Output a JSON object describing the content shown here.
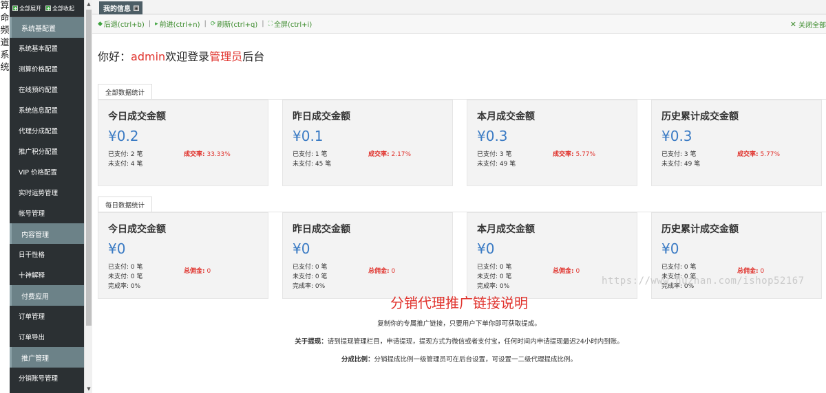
{
  "brand_chars": [
    "算",
    "命",
    "频",
    "道",
    "系",
    "统"
  ],
  "sidebar": {
    "expand_all": "全部展开",
    "collapse_all": "全部收起",
    "groups": [
      {
        "header": "系统基配置",
        "items": [
          "系统基本配置",
          "测算价格配置",
          "在线预约配置",
          "系统信息配置",
          "代理分成配置",
          "推广积分配置",
          "VIP 价格配置",
          "实时运势管理",
          "帐号管理"
        ]
      },
      {
        "header": "内容管理",
        "items": [
          "日干性格",
          "十神解释"
        ]
      },
      {
        "header": "付费应用",
        "items": [
          "订单管理",
          "订单导出"
        ]
      },
      {
        "header": "推广管理",
        "items": [
          "分销账号管理"
        ]
      }
    ]
  },
  "tabbar": {
    "tab_label": "我的信息"
  },
  "toolbar": {
    "back": "后退(ctrl+b)",
    "forward": "前进(ctrl+n)",
    "refresh": "刷新(ctrl+q)",
    "fullscreen": "全屏(ctrl+i)",
    "close_all": "关闭全部"
  },
  "greeting": {
    "prefix": "你好：",
    "user": "admin",
    "middle": "欢迎登录",
    "role": "管理员",
    "suffix": "后台"
  },
  "section_all": {
    "label": "全部数据统计",
    "cards": [
      {
        "title": "今日成交金额",
        "amount": "¥0.2",
        "paid": "已支付: 2 笔",
        "unpaid": "未支付: 4 笔",
        "rate_label": "成交率:",
        "rate": "33.33%"
      },
      {
        "title": "昨日成交金额",
        "amount": "¥0.1",
        "paid": "已支付: 1 笔",
        "unpaid": "未支付: 45 笔",
        "rate_label": "成交率:",
        "rate": "2.17%"
      },
      {
        "title": "本月成交金额",
        "amount": "¥0.3",
        "paid": "已支付: 3 笔",
        "unpaid": "未支付: 49 笔",
        "rate_label": "成交率:",
        "rate": "5.77%"
      },
      {
        "title": "历史累计成交金额",
        "amount": "¥0.3",
        "paid": "已支付: 3 笔",
        "unpaid": "未支付: 49 笔",
        "rate_label": "成交率:",
        "rate": "5.77%"
      }
    ]
  },
  "section_daily": {
    "label": "每日数据统计",
    "cards": [
      {
        "title": "今日成交金额",
        "amount": "¥0",
        "paid": "已支付: 0 笔",
        "unpaid": "未支付: 0 笔",
        "done": "完成率: 0%",
        "rate_label": "总佣金:",
        "rate": "0"
      },
      {
        "title": "昨日成交金额",
        "amount": "¥0",
        "paid": "已支付: 0 笔",
        "unpaid": "未支付: 0 笔",
        "done": "完成率: 0%",
        "rate_label": "总佣金:",
        "rate": "0"
      },
      {
        "title": "本月成交金额",
        "amount": "¥0",
        "paid": "已支付: 0 笔",
        "unpaid": "未支付: 0 笔",
        "done": "完成率: 0%",
        "rate_label": "总佣金:",
        "rate": "0"
      },
      {
        "title": "历史累计成交金额",
        "amount": "¥0",
        "paid": "已支付: 0 笔",
        "unpaid": "未支付: 0 笔",
        "done": "完成率: 0%",
        "rate_label": "总佣金:",
        "rate": "0"
      }
    ]
  },
  "watermark": "https://www.huzhan.com/ishop52167",
  "promo": {
    "title": "分销代理推广链接说明",
    "line1": "复制你的专属推广链接，只要用户下单你即可获取提成。",
    "line2_label": "关于提现：",
    "line2": "请到提现管理栏目，申请提现，提现方式为微信或者支付宝，任何时间内申请提现最迟24小时内到账。",
    "line3_label": "分成比例：",
    "line3": "分销提成比例一级管理员可在后台设置，可设置一二级代理提成比例。"
  },
  "colors": {
    "accent_red": "#e0322c",
    "amount_blue": "#3b7bc4",
    "sidebar_bg": "#2b3033",
    "sidebar_header": "#6c8288",
    "toolbar_green": "#3a8a2a"
  }
}
